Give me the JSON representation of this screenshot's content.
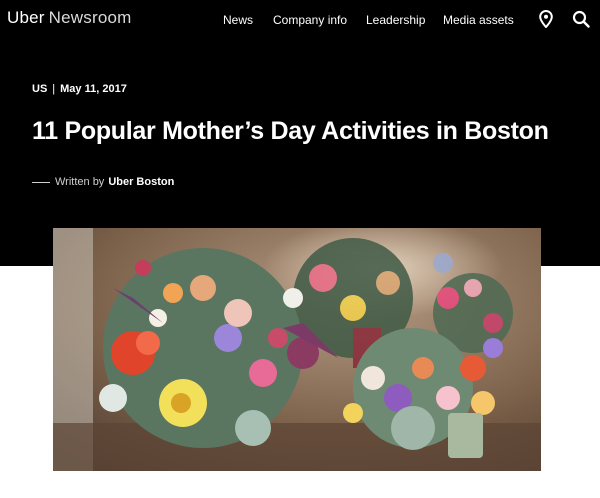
{
  "header": {
    "brand": "Uber",
    "section": "Newsroom",
    "nav": [
      "News",
      "Company info",
      "Leadership",
      "Media assets"
    ],
    "icons": {
      "location": "location-pin-icon",
      "search": "search-icon"
    }
  },
  "article": {
    "region": "US",
    "date": "May 11, 2017",
    "title": "11 Popular Mother’s Day Activities in Boston",
    "written_by_label": "Written by",
    "author": "Uber Boston"
  },
  "colors": {
    "header_bg": "#000000",
    "text": "#ffffff",
    "page_bg": "#ffffff"
  }
}
